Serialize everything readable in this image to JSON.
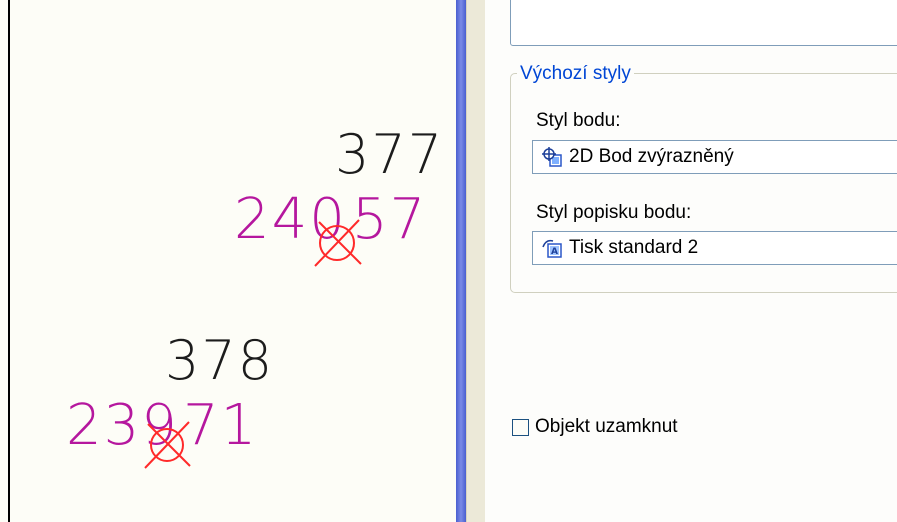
{
  "canvas": {
    "points": [
      {
        "number": "377",
        "height_left": "240",
        "height_right": "57"
      },
      {
        "number": "378",
        "height_left": "239",
        "height_right": "71"
      }
    ],
    "colors": {
      "number": "#1c1c1c",
      "height": "#b5179e",
      "marker": "#ff2a2a"
    }
  },
  "panel": {
    "group_title": "Výchozí styly",
    "point_style": {
      "label": "Styl bodu:",
      "value": "2D Bod zvýrazněný",
      "icon": "point-style-icon"
    },
    "label_style": {
      "label": "Styl popisku bodu:",
      "value": "Tisk standard 2",
      "icon": "label-style-icon"
    },
    "lock_checkbox": {
      "label": "Objekt uzamknut",
      "checked": false
    }
  }
}
